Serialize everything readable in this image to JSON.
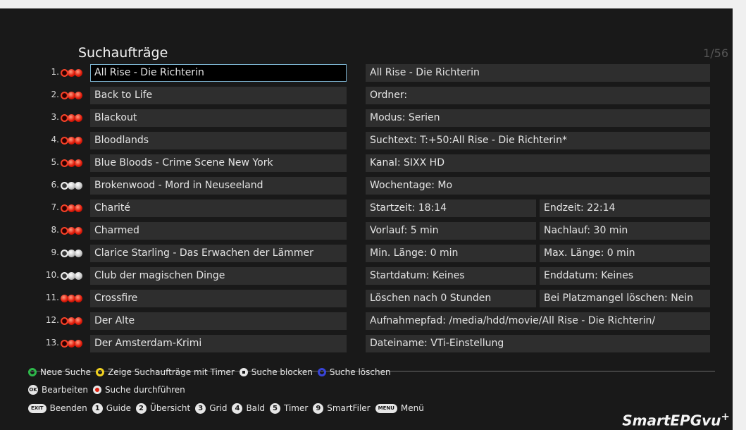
{
  "header": {
    "title": "Suchaufträge",
    "page": "1/56"
  },
  "list": [
    {
      "num": "1.",
      "name": "All Rise - Die Richterin",
      "status": "red",
      "selected": true
    },
    {
      "num": "2.",
      "name": "Back to Life",
      "status": "red"
    },
    {
      "num": "3.",
      "name": "Blackout",
      "status": "red"
    },
    {
      "num": "4.",
      "name": "Bloodlands",
      "status": "red"
    },
    {
      "num": "5.",
      "name": "Blue Bloods - Crime Scene New York",
      "status": "red"
    },
    {
      "num": "6.",
      "name": "Brokenwood - Mord in Neuseeland",
      "status": "grey"
    },
    {
      "num": "7.",
      "name": "Charité",
      "status": "red"
    },
    {
      "num": "8.",
      "name": "Charmed",
      "status": "red"
    },
    {
      "num": "9.",
      "name": "Clarice Starling - Das Erwachen der Lämmer",
      "status": "grey"
    },
    {
      "num": "10.",
      "name": "Club der magischen Dinge",
      "status": "grey"
    },
    {
      "num": "11.",
      "name": "Crossfire",
      "status": "red-solid"
    },
    {
      "num": "12.",
      "name": "Der Alte",
      "status": "red"
    },
    {
      "num": "13.",
      "name": "Der Amsterdam-Krimi",
      "status": "red"
    }
  ],
  "details": {
    "title": "All Rise - Die Richterin",
    "folder": "Ordner:",
    "mode": "Modus: Serien",
    "searchtext": "Suchtext: T:+50:All Rise - Die Richterin*",
    "channel": "Kanal: SIXX HD",
    "weekdays": "Wochentage:  Mo",
    "start_time": "Startzeit: 18:14",
    "end_time": "Endzeit: 22:14",
    "lead": "Vorlauf: 5 min",
    "lag": "Nachlauf: 30 min",
    "min_len": "Min. Länge: 0 min",
    "max_len": "Max. Länge: 0 min",
    "start_date": "Startdatum: Keines",
    "end_date": "Enddatum: Keines",
    "delete_after": "Löschen nach 0 Stunden",
    "delete_space": "Bei Platzmangel löschen: Nein",
    "record_path": "Aufnahmepfad: /media/hdd/movie/All Rise - Die Richterin/",
    "filename": "Dateiname: VTi-Einstellung"
  },
  "legend": {
    "green": "Neue Suche",
    "yellow": "Zeige Suchaufträge mit Timer",
    "stop": "Suche blocken",
    "blue": "Suche löschen",
    "ok_key": "OK",
    "ok": "Bearbeiten",
    "rec": "Suche durchführen",
    "exit_key": "EXIT",
    "exit": "Beenden",
    "k1": "1",
    "guide": "Guide",
    "k2": "2",
    "overview": "Übersicht",
    "k3": "3",
    "grid": "Grid",
    "k4": "4",
    "soon": "Bald",
    "k5": "5",
    "timer": "Timer",
    "k9": "9",
    "smartfiler": "SmartFiler",
    "menu_key": "MENU",
    "menu": "Menü"
  },
  "brand": {
    "name": "SmartEPGvu",
    "sup": "+"
  },
  "colors": {
    "background": "#191919",
    "row": "#2e2e2e",
    "selection_border": "#7ab0cc",
    "green": "#2db84a",
    "yellow": "#f0d020",
    "blue": "#3844d8",
    "red": "#e21d0c"
  }
}
